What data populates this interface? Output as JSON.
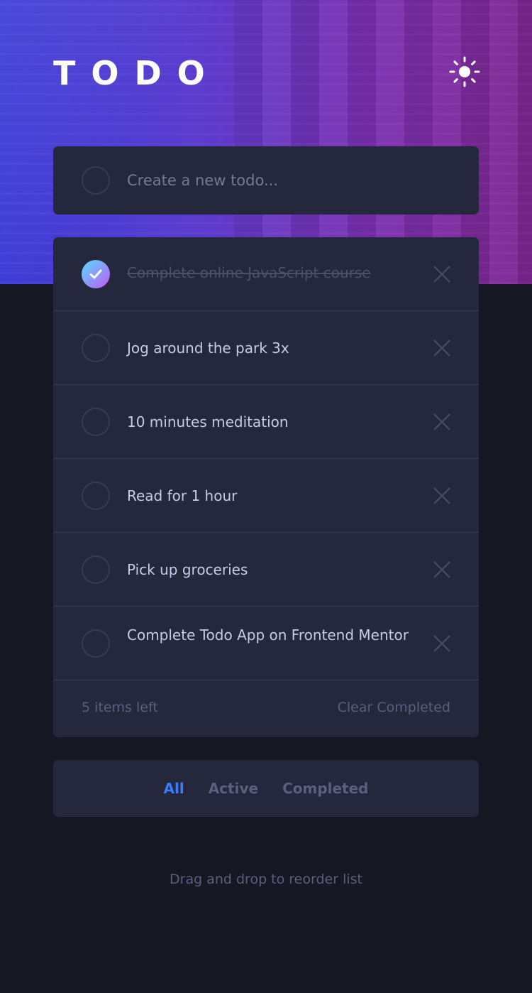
{
  "header": {
    "title": "TODO",
    "theme_toggle_icon": "sun-icon"
  },
  "new_todo": {
    "placeholder": "Create a new todo..."
  },
  "todos": [
    {
      "text": "Complete online JavaScript course",
      "completed": true
    },
    {
      "text": "Jog around the park 3x",
      "completed": false
    },
    {
      "text": "10 minutes meditation",
      "completed": false
    },
    {
      "text": "Read for 1 hour",
      "completed": false
    },
    {
      "text": "Pick up groceries",
      "completed": false
    },
    {
      "text": "Complete Todo App on Frontend Mentor",
      "completed": false
    }
  ],
  "footer": {
    "items_left": "5 items left",
    "clear_completed": "Clear Completed"
  },
  "filters": {
    "all": "All",
    "active": "Active",
    "completed": "Completed",
    "selected": "All"
  },
  "hint": "Drag and drop to reorder list",
  "colors": {
    "accent": "#3a7cfd",
    "check_gradient_start": "#57ddff",
    "check_gradient_end": "#c058f3",
    "card": "#25273c",
    "background": "#161722"
  }
}
